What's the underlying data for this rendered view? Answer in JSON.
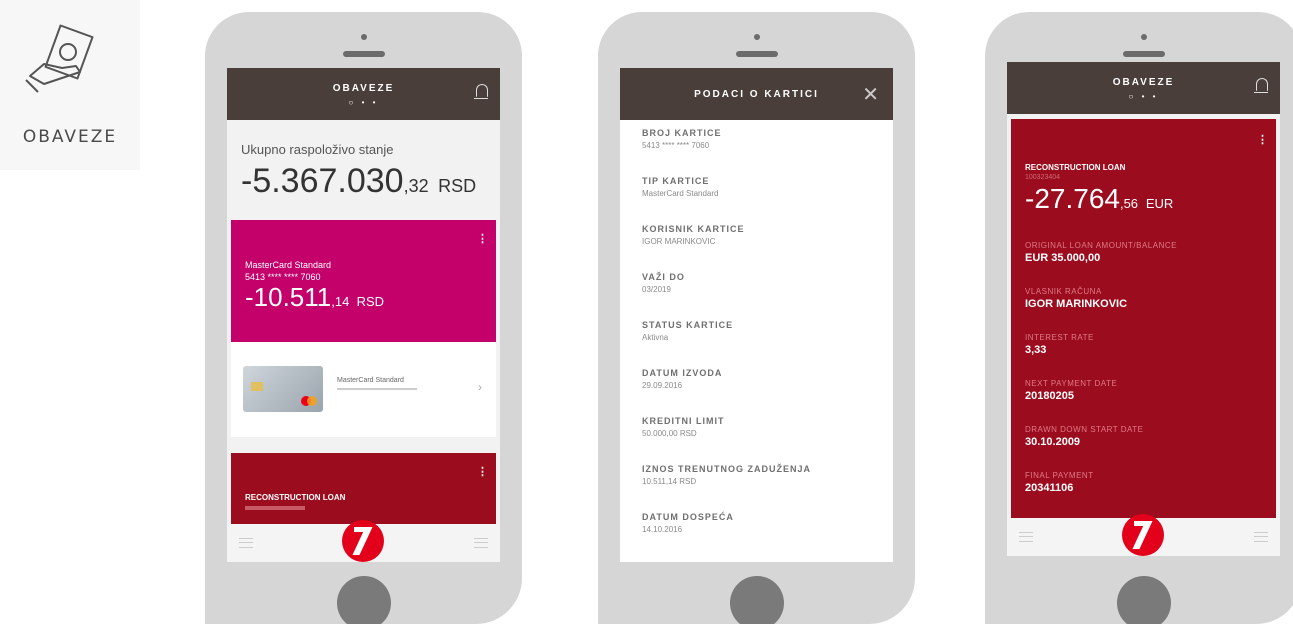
{
  "side": {
    "label": "OBAVEZE",
    "icon": "cash-hand-icon"
  },
  "screen1": {
    "title": "OBAVEZE",
    "pager": "○ • •",
    "total_label": "Ukupno raspoloživo stanje",
    "total_int": "-5.367.030",
    "total_dec": ",32",
    "total_cur": "RSD",
    "card": {
      "name": "MasterCard Standard",
      "number": "5413 **** **** 7060",
      "amount_int": "-10.511",
      "amount_dec": ",14",
      "currency": "RSD",
      "tile_name": "MasterCard Standard"
    },
    "loan_title": "RECONSTRUCTION LOAN",
    "colors": {
      "bar": "#4a3e3b",
      "pink": "#c4006b",
      "red": "#9b0c1e"
    }
  },
  "screen2": {
    "title": "PODACI O KARTICI",
    "close": "✕",
    "items": [
      {
        "label": "BROJ KARTICE",
        "value": "5413 **** **** 7060"
      },
      {
        "label": "TIP KARTICE",
        "value": "MasterCard Standard"
      },
      {
        "label": "KORISNIK KARTICE",
        "value": "IGOR MARINKOVIC"
      },
      {
        "label": "VAŽI DO",
        "value": "03/2019"
      },
      {
        "label": "STATUS KARTICE",
        "value": "Aktivna"
      },
      {
        "label": "DATUM IZVODA",
        "value": "29.09.2016"
      },
      {
        "label": "KREDITNI LIMIT",
        "value": "50.000,00 RSD"
      },
      {
        "label": "IZNOS TRENUTNOG ZADUŽENJA",
        "value": "10.511,14 RSD"
      },
      {
        "label": "DATUM DOSPEĆA",
        "value": "14.10.2016"
      }
    ]
  },
  "screen3": {
    "title": "OBAVEZE",
    "pager": "○ • •",
    "loan_title": "RECONSTRUCTION LOAN",
    "loan_id": "100323404",
    "amount_int": "-27.764",
    "amount_dec": ",56",
    "currency": "EUR",
    "items": [
      {
        "label": "ORIGINAL LOAN AMOUNT/BALANCE",
        "value": "EUR 35.000,00"
      },
      {
        "label": "VLASNIK RAČUNA",
        "value": "IGOR MARINKOVIC"
      },
      {
        "label": "INTEREST RATE",
        "value": "3,33"
      },
      {
        "label": "NEXT PAYMENT DATE",
        "value": "20180205"
      },
      {
        "label": "DRAWN DOWN START DATE",
        "value": "30.10.2009"
      },
      {
        "label": "FINAL PAYMENT",
        "value": "20341106"
      }
    ]
  }
}
